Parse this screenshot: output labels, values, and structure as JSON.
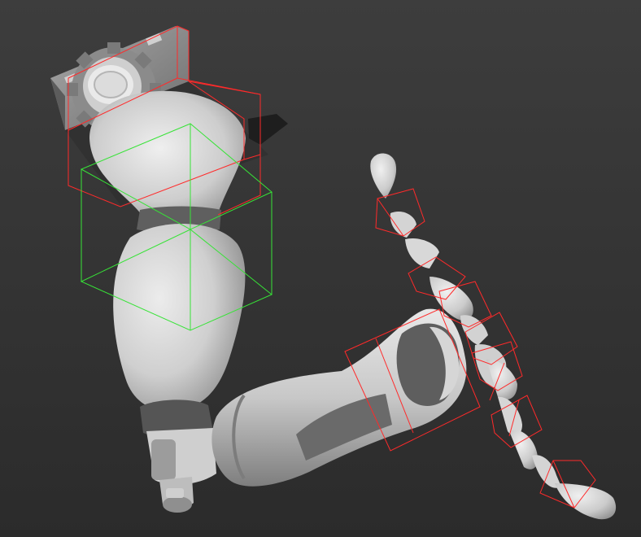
{
  "viewport": {
    "background_color": "#333333",
    "background_gradient_top": "#3d3d3d",
    "background_gradient_bottom": "#2b2b2b"
  },
  "model": {
    "material_color": "#d2d2d2",
    "material_shadow": "#8e8e8e",
    "material_dark": "#5a5a5a",
    "parts": [
      "shoulder-mount",
      "gear",
      "upper-arm",
      "elbow",
      "forearm",
      "wrist",
      "finger-segments"
    ]
  },
  "gizmos": {
    "selection_color": "#ff2a2a",
    "active_color": "#37e337",
    "box_count": 12
  }
}
